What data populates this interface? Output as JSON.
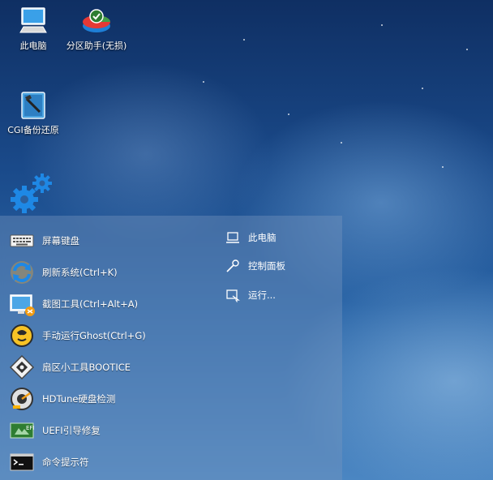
{
  "desktop": {
    "icons": [
      {
        "label": "此电脑",
        "icon": "computer-icon"
      },
      {
        "label": "分区助手(无损)",
        "icon": "partition-assistant-icon"
      },
      {
        "label": "CGI备份还原",
        "icon": "cgi-backup-icon"
      }
    ]
  },
  "start_menu": {
    "left_items": [
      {
        "label": "屏幕键盘",
        "icon": "keyboard-icon"
      },
      {
        "label": "刷新系统(Ctrl+K)",
        "icon": "refresh-icon"
      },
      {
        "label": "截图工具(Ctrl+Alt+A)",
        "icon": "screenshot-tool-icon"
      },
      {
        "label": "手动运行Ghost(Ctrl+G)",
        "icon": "ghost-icon"
      },
      {
        "label": "扇区小工具BOOTICE",
        "icon": "bootice-icon"
      },
      {
        "label": "HDTune硬盘检测",
        "icon": "hdtune-icon"
      },
      {
        "label": "UEFI引导修复",
        "icon": "uefi-repair-icon"
      },
      {
        "label": "命令提示符",
        "icon": "command-prompt-icon"
      }
    ],
    "right_items": [
      {
        "label": "此电脑",
        "icon": "laptop-icon"
      },
      {
        "label": "控制面板",
        "icon": "wrench-icon"
      },
      {
        "label": "运行...",
        "icon": "run-icon"
      }
    ]
  },
  "colors": {
    "wallpaper_top": "#0f2f63",
    "wallpaper_bottom": "#4b86c2",
    "gear_blue": "#1e88e5"
  }
}
